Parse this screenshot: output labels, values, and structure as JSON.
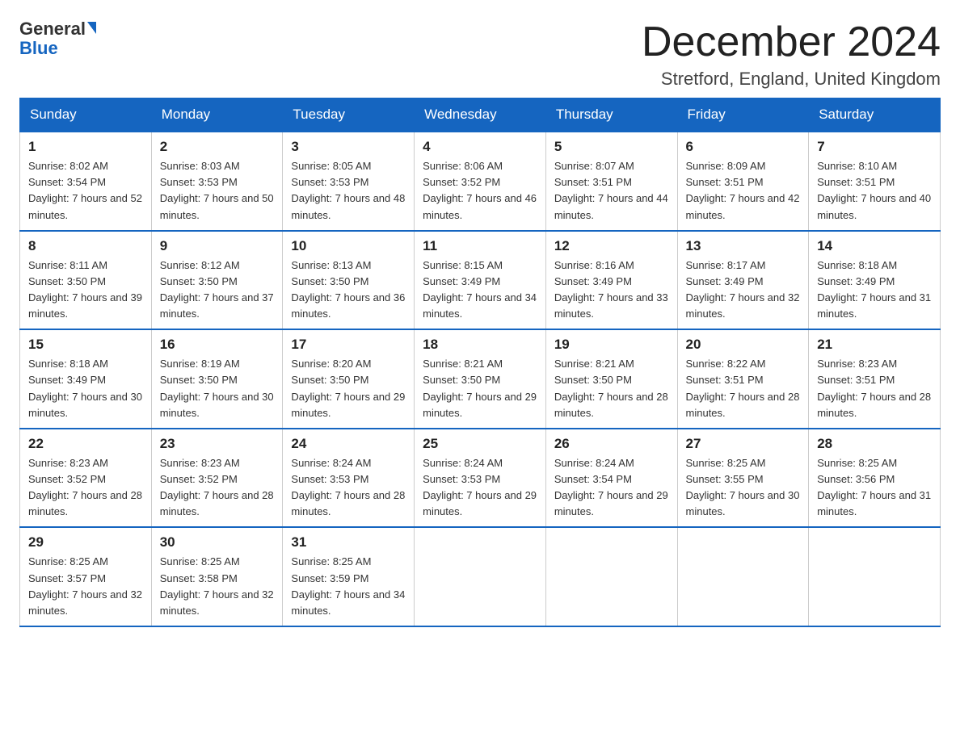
{
  "logo": {
    "general": "General",
    "arrow": "▶",
    "blue": "Blue"
  },
  "header": {
    "month": "December 2024",
    "location": "Stretford, England, United Kingdom"
  },
  "days_of_week": [
    "Sunday",
    "Monday",
    "Tuesday",
    "Wednesday",
    "Thursday",
    "Friday",
    "Saturday"
  ],
  "weeks": [
    [
      {
        "day": "1",
        "sunrise": "Sunrise: 8:02 AM",
        "sunset": "Sunset: 3:54 PM",
        "daylight": "Daylight: 7 hours and 52 minutes."
      },
      {
        "day": "2",
        "sunrise": "Sunrise: 8:03 AM",
        "sunset": "Sunset: 3:53 PM",
        "daylight": "Daylight: 7 hours and 50 minutes."
      },
      {
        "day": "3",
        "sunrise": "Sunrise: 8:05 AM",
        "sunset": "Sunset: 3:53 PM",
        "daylight": "Daylight: 7 hours and 48 minutes."
      },
      {
        "day": "4",
        "sunrise": "Sunrise: 8:06 AM",
        "sunset": "Sunset: 3:52 PM",
        "daylight": "Daylight: 7 hours and 46 minutes."
      },
      {
        "day": "5",
        "sunrise": "Sunrise: 8:07 AM",
        "sunset": "Sunset: 3:51 PM",
        "daylight": "Daylight: 7 hours and 44 minutes."
      },
      {
        "day": "6",
        "sunrise": "Sunrise: 8:09 AM",
        "sunset": "Sunset: 3:51 PM",
        "daylight": "Daylight: 7 hours and 42 minutes."
      },
      {
        "day": "7",
        "sunrise": "Sunrise: 8:10 AM",
        "sunset": "Sunset: 3:51 PM",
        "daylight": "Daylight: 7 hours and 40 minutes."
      }
    ],
    [
      {
        "day": "8",
        "sunrise": "Sunrise: 8:11 AM",
        "sunset": "Sunset: 3:50 PM",
        "daylight": "Daylight: 7 hours and 39 minutes."
      },
      {
        "day": "9",
        "sunrise": "Sunrise: 8:12 AM",
        "sunset": "Sunset: 3:50 PM",
        "daylight": "Daylight: 7 hours and 37 minutes."
      },
      {
        "day": "10",
        "sunrise": "Sunrise: 8:13 AM",
        "sunset": "Sunset: 3:50 PM",
        "daylight": "Daylight: 7 hours and 36 minutes."
      },
      {
        "day": "11",
        "sunrise": "Sunrise: 8:15 AM",
        "sunset": "Sunset: 3:49 PM",
        "daylight": "Daylight: 7 hours and 34 minutes."
      },
      {
        "day": "12",
        "sunrise": "Sunrise: 8:16 AM",
        "sunset": "Sunset: 3:49 PM",
        "daylight": "Daylight: 7 hours and 33 minutes."
      },
      {
        "day": "13",
        "sunrise": "Sunrise: 8:17 AM",
        "sunset": "Sunset: 3:49 PM",
        "daylight": "Daylight: 7 hours and 32 minutes."
      },
      {
        "day": "14",
        "sunrise": "Sunrise: 8:18 AM",
        "sunset": "Sunset: 3:49 PM",
        "daylight": "Daylight: 7 hours and 31 minutes."
      }
    ],
    [
      {
        "day": "15",
        "sunrise": "Sunrise: 8:18 AM",
        "sunset": "Sunset: 3:49 PM",
        "daylight": "Daylight: 7 hours and 30 minutes."
      },
      {
        "day": "16",
        "sunrise": "Sunrise: 8:19 AM",
        "sunset": "Sunset: 3:50 PM",
        "daylight": "Daylight: 7 hours and 30 minutes."
      },
      {
        "day": "17",
        "sunrise": "Sunrise: 8:20 AM",
        "sunset": "Sunset: 3:50 PM",
        "daylight": "Daylight: 7 hours and 29 minutes."
      },
      {
        "day": "18",
        "sunrise": "Sunrise: 8:21 AM",
        "sunset": "Sunset: 3:50 PM",
        "daylight": "Daylight: 7 hours and 29 minutes."
      },
      {
        "day": "19",
        "sunrise": "Sunrise: 8:21 AM",
        "sunset": "Sunset: 3:50 PM",
        "daylight": "Daylight: 7 hours and 28 minutes."
      },
      {
        "day": "20",
        "sunrise": "Sunrise: 8:22 AM",
        "sunset": "Sunset: 3:51 PM",
        "daylight": "Daylight: 7 hours and 28 minutes."
      },
      {
        "day": "21",
        "sunrise": "Sunrise: 8:23 AM",
        "sunset": "Sunset: 3:51 PM",
        "daylight": "Daylight: 7 hours and 28 minutes."
      }
    ],
    [
      {
        "day": "22",
        "sunrise": "Sunrise: 8:23 AM",
        "sunset": "Sunset: 3:52 PM",
        "daylight": "Daylight: 7 hours and 28 minutes."
      },
      {
        "day": "23",
        "sunrise": "Sunrise: 8:23 AM",
        "sunset": "Sunset: 3:52 PM",
        "daylight": "Daylight: 7 hours and 28 minutes."
      },
      {
        "day": "24",
        "sunrise": "Sunrise: 8:24 AM",
        "sunset": "Sunset: 3:53 PM",
        "daylight": "Daylight: 7 hours and 28 minutes."
      },
      {
        "day": "25",
        "sunrise": "Sunrise: 8:24 AM",
        "sunset": "Sunset: 3:53 PM",
        "daylight": "Daylight: 7 hours and 29 minutes."
      },
      {
        "day": "26",
        "sunrise": "Sunrise: 8:24 AM",
        "sunset": "Sunset: 3:54 PM",
        "daylight": "Daylight: 7 hours and 29 minutes."
      },
      {
        "day": "27",
        "sunrise": "Sunrise: 8:25 AM",
        "sunset": "Sunset: 3:55 PM",
        "daylight": "Daylight: 7 hours and 30 minutes."
      },
      {
        "day": "28",
        "sunrise": "Sunrise: 8:25 AM",
        "sunset": "Sunset: 3:56 PM",
        "daylight": "Daylight: 7 hours and 31 minutes."
      }
    ],
    [
      {
        "day": "29",
        "sunrise": "Sunrise: 8:25 AM",
        "sunset": "Sunset: 3:57 PM",
        "daylight": "Daylight: 7 hours and 32 minutes."
      },
      {
        "day": "30",
        "sunrise": "Sunrise: 8:25 AM",
        "sunset": "Sunset: 3:58 PM",
        "daylight": "Daylight: 7 hours and 32 minutes."
      },
      {
        "day": "31",
        "sunrise": "Sunrise: 8:25 AM",
        "sunset": "Sunset: 3:59 PM",
        "daylight": "Daylight: 7 hours and 34 minutes."
      },
      null,
      null,
      null,
      null
    ]
  ]
}
